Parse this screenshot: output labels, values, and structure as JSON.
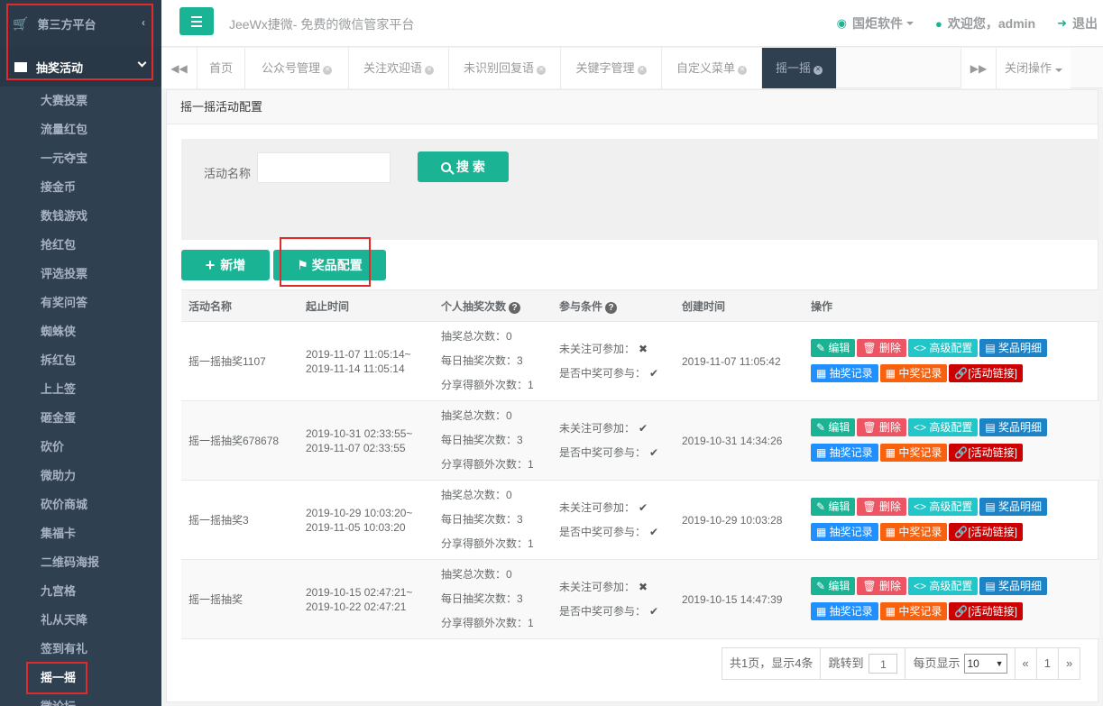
{
  "sidebar": {
    "platform_label": "第三方平台",
    "group_label": "抽奖活动",
    "items": [
      "大赛投票",
      "流量红包",
      "一元夺宝",
      "接金币",
      "数钱游戏",
      "抢红包",
      "评选投票",
      "有奖问答",
      "蜘蛛侠",
      "拆红包",
      "上上签",
      "砸金蛋",
      "砍价",
      "微助力",
      "砍价商城",
      "集福卡",
      "二维码海报",
      "九宫格",
      "礼从天降",
      "签到有礼",
      "摇一摇",
      "微论坛"
    ],
    "active_item": "摇一摇"
  },
  "header": {
    "brand": "JeeWx捷微- 免费的微信管家平台",
    "company": "国炬软件",
    "welcome": "欢迎您，admin",
    "logout": "退出"
  },
  "tabs": {
    "items": [
      {
        "label": "首页",
        "closable": false
      },
      {
        "label": "公众号管理",
        "closable": true
      },
      {
        "label": "关注欢迎语",
        "closable": true
      },
      {
        "label": "未识别回复语",
        "closable": true
      },
      {
        "label": "关键字管理",
        "closable": true
      },
      {
        "label": "自定义菜单",
        "closable": true
      },
      {
        "label": "摇一摇",
        "closable": true,
        "active": true
      }
    ],
    "close_ops": "关闭操作"
  },
  "panel": {
    "title": "摇一摇活动配置",
    "search_label": "活动名称",
    "search_button": "搜 索",
    "add_button": "新增",
    "prize_button": "奖品配置"
  },
  "table": {
    "headers": [
      "活动名称",
      "起止时间",
      "个人抽奖次数",
      "参与条件",
      "创建时间",
      "操作"
    ],
    "rows": [
      {
        "name": "摇一摇抽奖1107",
        "start": "2019-11-07 11:05:14~",
        "end": "2019-11-14 11:05:14",
        "total": "抽奖总次数：0",
        "daily": "每日抽奖次数：3",
        "share": "分享得额外次数：1",
        "cond1": "未关注可参加：",
        "cond1_ok": false,
        "cond2": "是否中奖可参与：",
        "cond2_ok": true,
        "created": "2019-11-07 11:05:42"
      },
      {
        "name": "摇一摇抽奖678678",
        "start": "2019-10-31 02:33:55~",
        "end": "2019-11-07 02:33:55",
        "total": "抽奖总次数：0",
        "daily": "每日抽奖次数：3",
        "share": "分享得额外次数：1",
        "cond1": "未关注可参加：",
        "cond1_ok": true,
        "cond2": "是否中奖可参与：",
        "cond2_ok": true,
        "created": "2019-10-31 14:34:26"
      },
      {
        "name": "摇一摇抽奖3",
        "start": "2019-10-29 10:03:20~",
        "end": "2019-11-05 10:03:20",
        "total": "抽奖总次数：0",
        "daily": "每日抽奖次数：3",
        "share": "分享得额外次数：1",
        "cond1": "未关注可参加：",
        "cond1_ok": true,
        "cond2": "是否中奖可参与：",
        "cond2_ok": true,
        "created": "2019-10-29 10:03:28"
      },
      {
        "name": "摇一摇抽奖",
        "start": "2019-10-15 02:47:21~",
        "end": "2019-10-22 02:47:21",
        "total": "抽奖总次数：0",
        "daily": "每日抽奖次数：3",
        "share": "分享得额外次数：1",
        "cond1": "未关注可参加：",
        "cond1_ok": false,
        "cond2": "是否中奖可参与：",
        "cond2_ok": true,
        "created": "2019-10-15 14:47:39"
      }
    ],
    "ops": {
      "edit": "编辑",
      "del": "删除",
      "adv": "高级配置",
      "detail": "奖品明细",
      "rec": "抽奖记录",
      "win": "中奖记录",
      "link": "[活动链接]"
    }
  },
  "pager": {
    "summary": "共1页，显示4条",
    "jump_label": "跳转到",
    "jump_value": "1",
    "per_page_label": "每页显示",
    "per_page_value": "10",
    "prev": "«",
    "page": "1",
    "next": "»"
  },
  "colors": {
    "primary": "#1ab394",
    "sidebar": "#2f4050",
    "highlight": "#e12a2a"
  }
}
